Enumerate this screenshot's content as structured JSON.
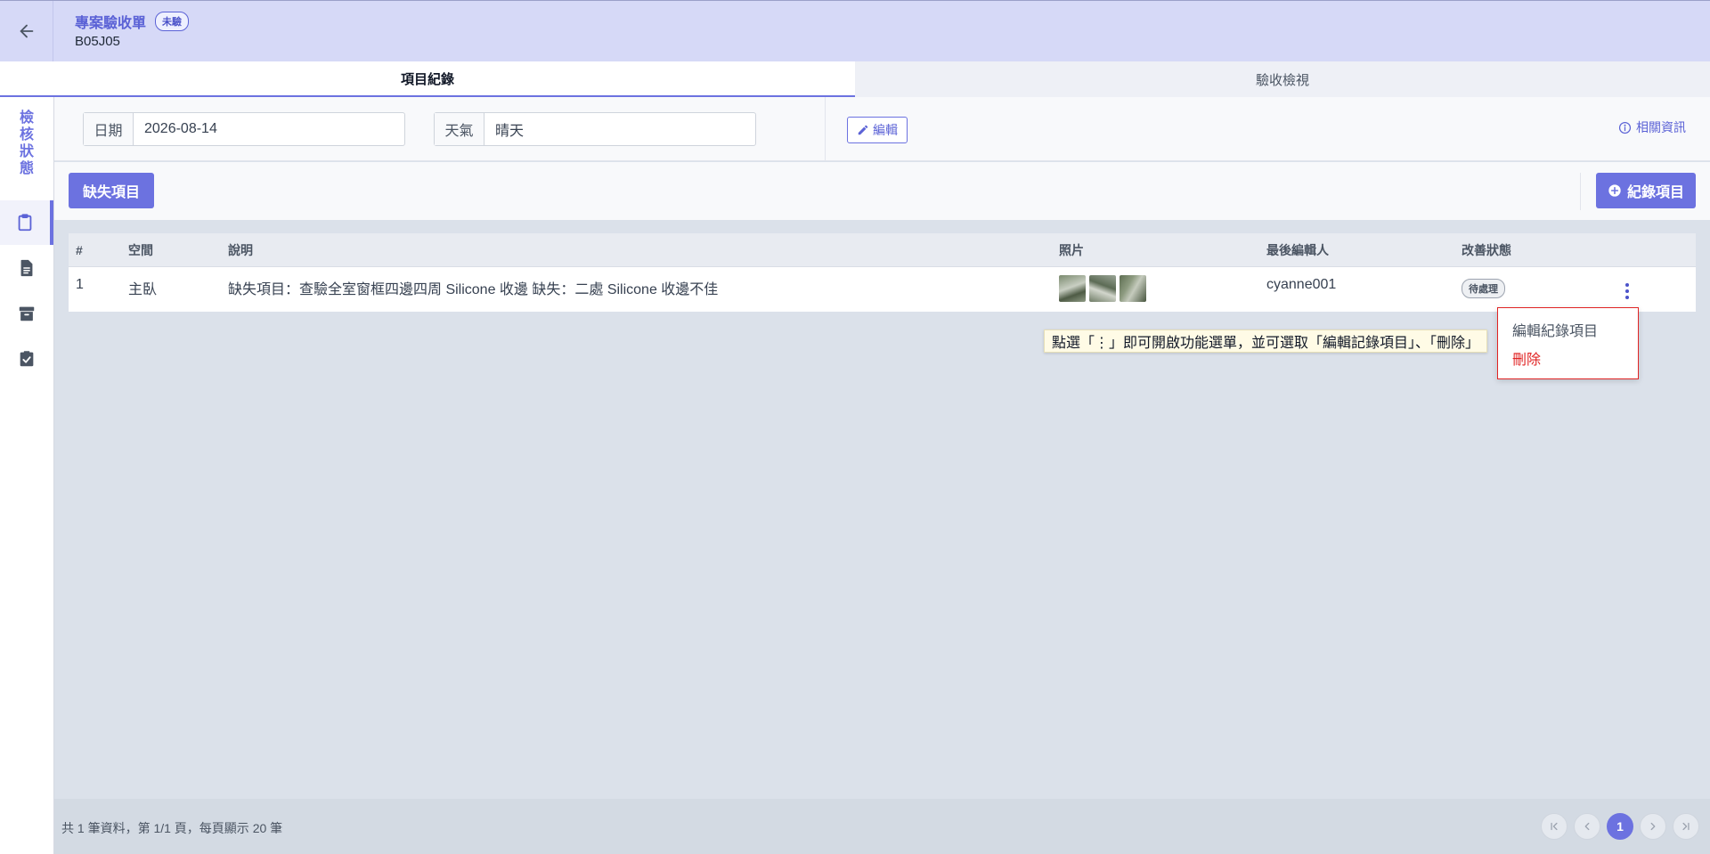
{
  "header": {
    "title": "專案驗收單",
    "status_badge": "未驗",
    "code": "B05J05"
  },
  "tabs": [
    {
      "label": "項目紀錄",
      "active": true
    },
    {
      "label": "驗收檢視",
      "active": false
    }
  ],
  "rail": {
    "label": "檢核狀態",
    "items": [
      "clipboard-icon",
      "document-icon",
      "archive-icon",
      "clipboard-check-icon"
    ]
  },
  "info": {
    "date_label": "日期",
    "date_value": "2026-08-14",
    "weather_label": "天氣",
    "weather_value": "晴天",
    "edit_label": "編輯",
    "related_label": "相關資訊"
  },
  "actions": {
    "defect_label": "缺失項目",
    "record_label": "紀錄項目"
  },
  "table": {
    "columns": [
      "#",
      "空間",
      "說明",
      "照片",
      "最後編輯人",
      "改善狀態"
    ],
    "rows": [
      {
        "num": "1",
        "space": "主臥",
        "desc": "缺失項目：查驗全室窗框四邊四周 Silicone 收邊 缺失：二處 Silicone 收邊不佳",
        "photos": [
          "photo-1",
          "photo-2",
          "photo-3"
        ],
        "editor": "cyanne001",
        "status": "待處理"
      }
    ]
  },
  "tooltip": "點選「⋮」即可開啟功能選單，並可選取「編輯記錄項目」、「刪除」",
  "menu": {
    "edit_label": "編輯紀錄項目",
    "delete_label": "刪除"
  },
  "footer": {
    "summary": "共 1 筆資料，第 1/1 頁，每頁顯示 20 筆",
    "current_page": "1"
  },
  "colors": {
    "accent": "#6c72e0",
    "header_bg": "#d6d9f7",
    "danger": "#e02424"
  }
}
